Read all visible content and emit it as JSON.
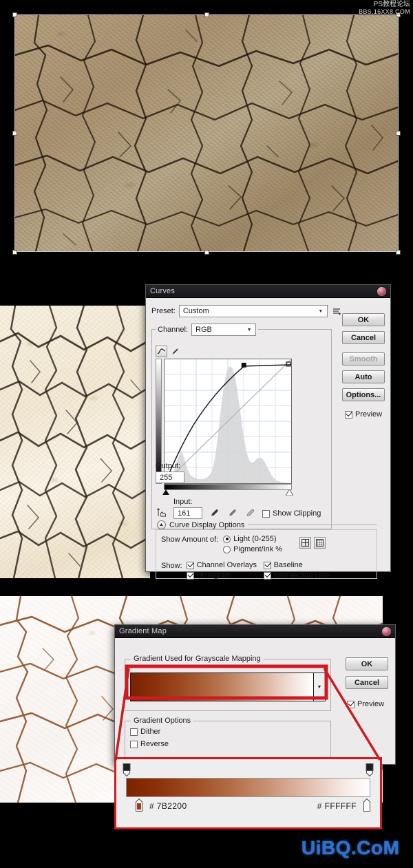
{
  "watermarks": {
    "top_line1": "PS教程论坛",
    "top_line2": "BBS.16XX8.COM",
    "bottom": "UiBQ.CoM"
  },
  "canvas": {
    "top_image_alt": "cracked dry earth texture, tan",
    "middle_image_alt": "cracked dry earth texture, cream",
    "bottom_image_alt": "cracked dry earth texture, white with rust cracks"
  },
  "curves_dialog": {
    "title": "Curves",
    "preset": {
      "label": "Preset:",
      "value": "Custom"
    },
    "channel": {
      "label": "Channel:",
      "value": "RGB"
    },
    "output": {
      "label": "Output:",
      "value": "255"
    },
    "input": {
      "label": "Input:",
      "value": "161"
    },
    "show_clipping": {
      "label": "Show Clipping",
      "checked": false
    },
    "curve_display_options": {
      "label": "Curve Display Options"
    },
    "show_amount_of": {
      "label": "Show Amount of:",
      "options": [
        {
          "label": "Light  (0-255)",
          "selected": true
        },
        {
          "label": "Pigment/Ink %",
          "selected": false
        }
      ]
    },
    "show": {
      "label": "Show:",
      "items": [
        {
          "label": "Channel Overlays",
          "checked": true
        },
        {
          "label": "Baseline",
          "checked": true
        },
        {
          "label": "Histogram",
          "checked": true
        },
        {
          "label": "Intersection Line",
          "checked": true
        }
      ]
    },
    "buttons": [
      {
        "label": "OK",
        "disabled": false
      },
      {
        "label": "Cancel",
        "disabled": false
      },
      {
        "label": "Smooth",
        "disabled": true
      },
      {
        "label": "Auto",
        "disabled": false
      },
      {
        "label": "Options...",
        "disabled": false
      }
    ],
    "preview": {
      "label": "Preview",
      "checked": true
    },
    "tools": [
      "curve-tool-icon",
      "pencil-tool-icon",
      "target-adjust-icon",
      "black-point-eyedropper-icon",
      "gray-point-eyedropper-icon",
      "white-point-eyedropper-icon"
    ],
    "grid_buttons": [
      "grid-quarter-icon",
      "grid-tenth-icon"
    ]
  },
  "gradient_map_dialog": {
    "title": "Gradient Map",
    "group_mapping": "Gradient Used for Grayscale Mapping",
    "group_options": "Gradient Options",
    "dither": {
      "label": "Dither",
      "checked": false
    },
    "reverse": {
      "label": "Reverse",
      "checked": false
    },
    "buttons": [
      {
        "label": "OK",
        "disabled": false
      },
      {
        "label": "Cancel",
        "disabled": false
      }
    ],
    "preview": {
      "label": "Preview",
      "checked": true
    }
  },
  "gradient_detail": {
    "left_stop_color": "# 7B2200",
    "right_stop_color": "# FFFFFF",
    "left_stop_hex": "#7B2200",
    "right_stop_hex": "#FFFFFF"
  },
  "colors": {
    "annotation_red": "#cc1b22",
    "dialog_bg": "#eceaea",
    "titlebar": "#1b1a1e",
    "watermark_blue": "#2f6fd0"
  }
}
